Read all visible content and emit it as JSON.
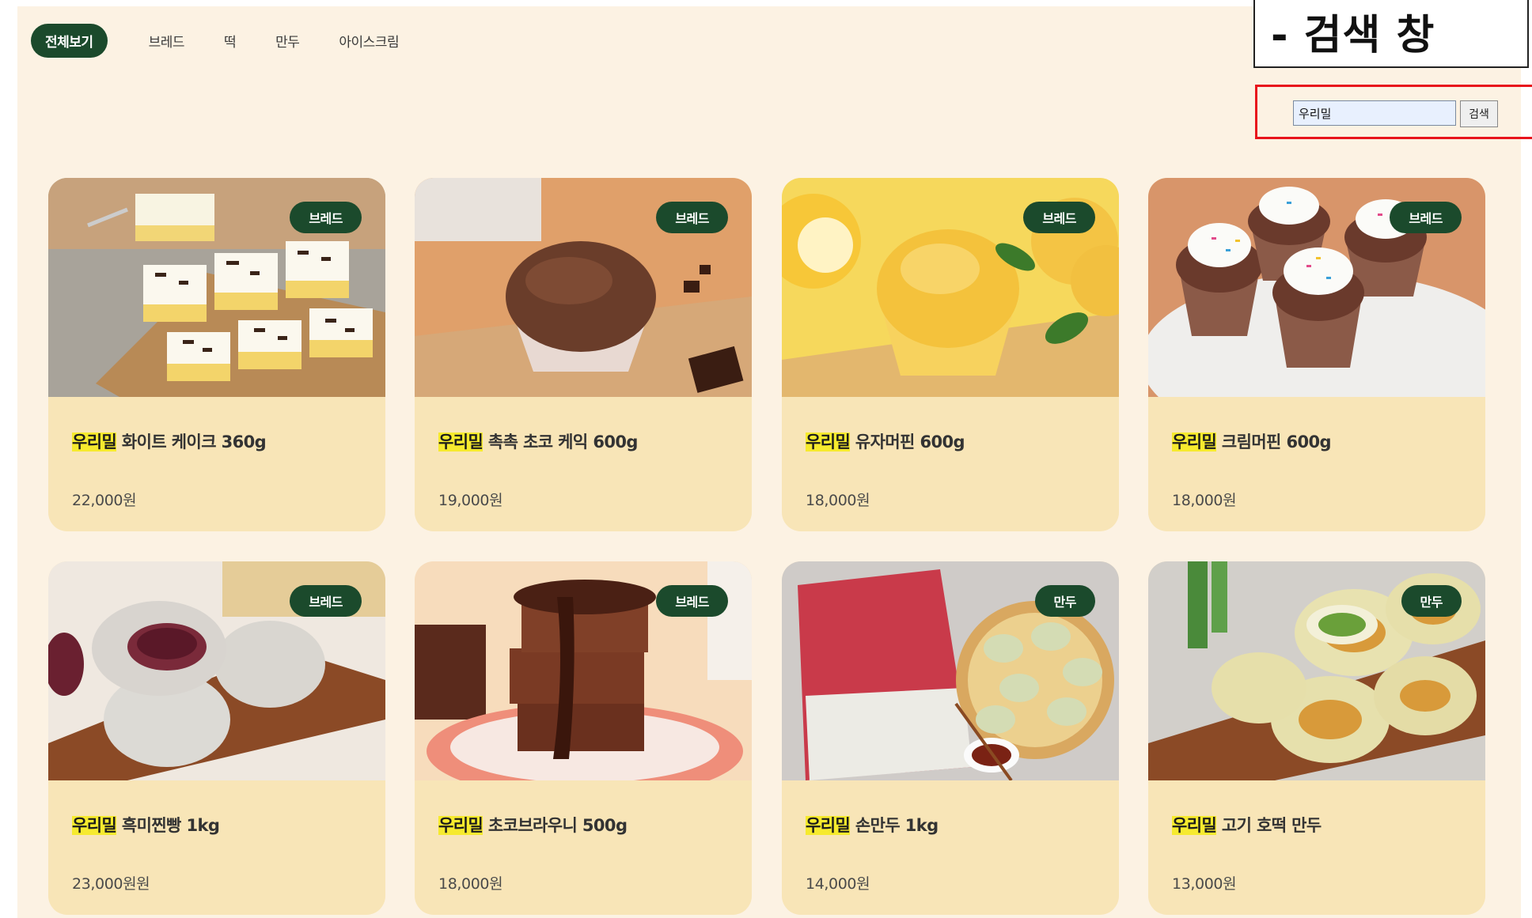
{
  "nav": {
    "tabs": [
      {
        "label": "전체보기",
        "active": true
      },
      {
        "label": "브레드",
        "active": false
      },
      {
        "label": "떡",
        "active": false
      },
      {
        "label": "만두",
        "active": false
      },
      {
        "label": "아이스크림",
        "active": false
      }
    ]
  },
  "annotation": {
    "label": "- 검색 창"
  },
  "search": {
    "value": "우리밀",
    "button_label": "검색"
  },
  "products": [
    {
      "badge": "브레드",
      "highlight": "우리밀",
      "name": " 화이트 케이크 360g",
      "price": "22,000원"
    },
    {
      "badge": "브레드",
      "highlight": "우리밀",
      "name": " 촉촉 초코 케익 600g",
      "price": "19,000원"
    },
    {
      "badge": "브레드",
      "highlight": "우리밀",
      "name": " 유자머핀 600g",
      "price": "18,000원"
    },
    {
      "badge": "브레드",
      "highlight": "우리밀",
      "name": " 크림머핀 600g",
      "price": "18,000원"
    },
    {
      "badge": "브레드",
      "highlight": "우리밀",
      "name": " 흑미찐빵 1kg",
      "price": "23,000원원"
    },
    {
      "badge": "브레드",
      "highlight": "우리밀",
      "name": " 초코브라우니 500g",
      "price": "18,000원"
    },
    {
      "badge": "만두",
      "highlight": "우리밀",
      "name": " 손만두 1kg",
      "price": "14,000원"
    },
    {
      "badge": "만두",
      "highlight": "우리밀",
      "name": " 고기 호떡 만두",
      "price": "13,000원"
    }
  ],
  "colors": {
    "accent": "#1b4a2c",
    "background": "#fcf2e3",
    "card": "#f8e5b7",
    "highlight": "#f6ea2e",
    "annotation_border": "#e8141c"
  }
}
